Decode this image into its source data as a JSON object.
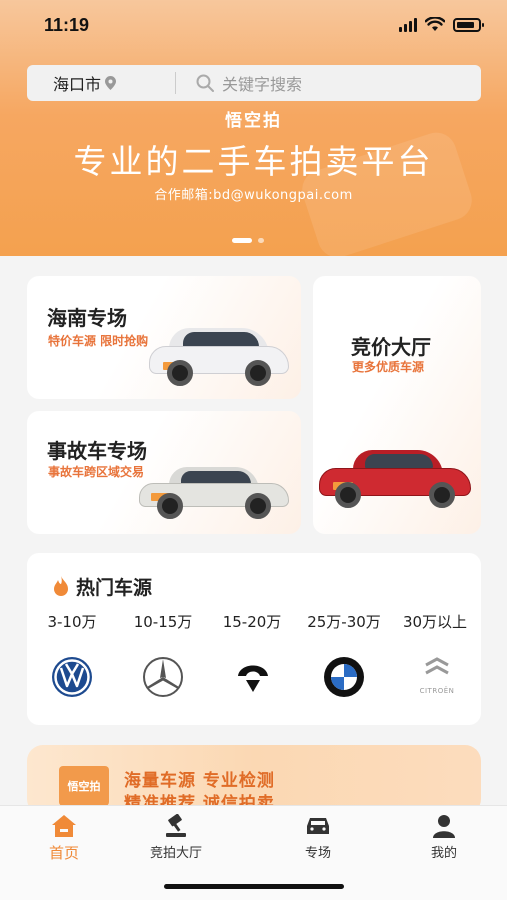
{
  "status_bar": {
    "time": "11:19"
  },
  "search": {
    "city": "海口市",
    "placeholder": "关键字搜索"
  },
  "banner": {
    "brand": "悟空拍",
    "title": "专业的二手车拍卖平台",
    "subtitle": "合作邮箱:bd@wukongpai.com"
  },
  "cards": {
    "hainan": {
      "title": "海南专场",
      "subtitle": "特价车源  限时抢购"
    },
    "accident": {
      "title": "事故车专场",
      "subtitle": "事故车跨区域交易"
    },
    "bidding": {
      "title": "竞价大厅",
      "subtitle": "更多优质车源"
    }
  },
  "hot": {
    "title": "热门车源",
    "prices": [
      "3-10万",
      "10-15万",
      "15-20万",
      "25万-30万",
      "30万以上"
    ],
    "brands": [
      "volkswagen-logo",
      "mercedes-benz-logo",
      "nio-logo",
      "bmw-logo",
      "citroen-logo"
    ],
    "citroen_text": "CITROËN"
  },
  "promo": {
    "logo_text": "悟空拍",
    "line1": "海量车源  专业检测",
    "line2": "精准推荐  诚信拍卖"
  },
  "tabbar": {
    "items": [
      {
        "label": "首页",
        "icon": "home-icon",
        "active": true
      },
      {
        "label": "竞拍大厅",
        "icon": "gavel-icon",
        "active": false
      },
      {
        "label": "专场",
        "icon": "car-icon",
        "active": false
      },
      {
        "label": "我的",
        "icon": "user-icon",
        "active": false
      }
    ]
  },
  "colors": {
    "accent": "#f08a38",
    "header": "#f4a14f"
  }
}
